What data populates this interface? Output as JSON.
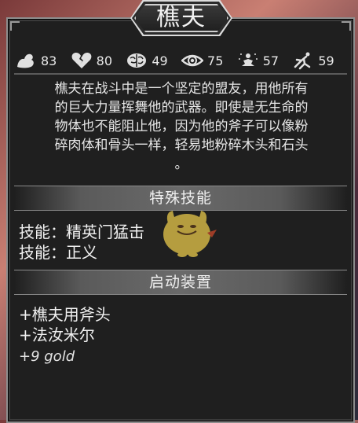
{
  "title": "樵夫",
  "stats": [
    {
      "icon": "strength-arm-icon",
      "value": "83"
    },
    {
      "icon": "broken-heart-icon",
      "value": "80"
    },
    {
      "icon": "brain-icon",
      "value": "49"
    },
    {
      "icon": "eye-icon",
      "value": "75"
    },
    {
      "icon": "meditation-icon",
      "value": "57"
    },
    {
      "icon": "running-figure-icon",
      "value": "59"
    }
  ],
  "description_lines": [
    "樵夫在战斗中是一个坚定的盟友，用他所有",
    "的巨大力量挥舞他的武器。即使是无生命的",
    "物体也不能阻止他，因为他的斧子可以像粉",
    "碎肉体和骨头一样，轻易地粉碎木头和石头",
    "。"
  ],
  "skills_section": {
    "title": "特殊技能",
    "items": [
      "技能：精英门猛击",
      "技能：正义"
    ]
  },
  "equipment_section": {
    "title": "启动装置",
    "items": [
      "+樵夫用斧头",
      "+法汝米尔"
    ],
    "gold": "+9 gold"
  },
  "colors": {
    "panel": "#1f1f1f",
    "border": "#8e8e8e",
    "text": "#e6e6e6",
    "mascot": "#e7c84a"
  }
}
